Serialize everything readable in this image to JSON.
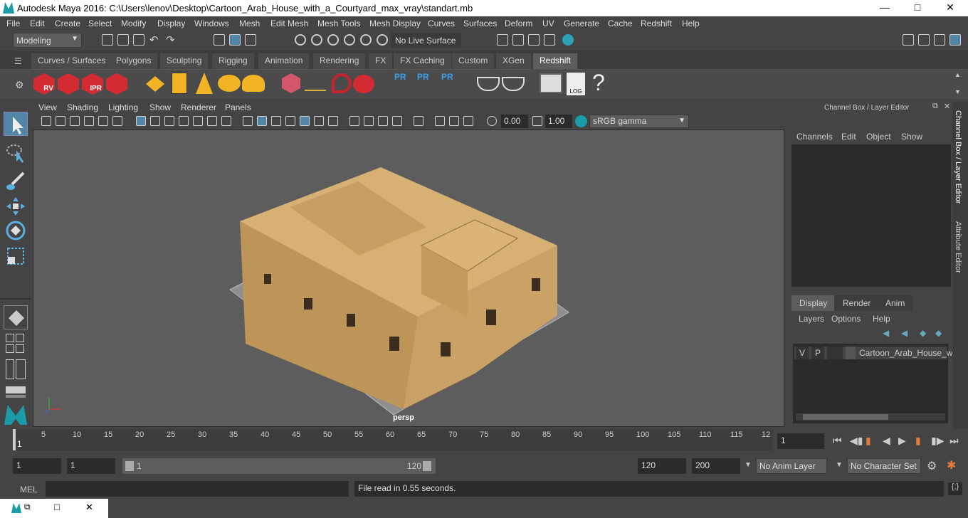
{
  "window": {
    "title": "Autodesk Maya 2016: C:\\Users\\lenov\\Desktop\\Cartoon_Arab_House_with_a_Courtyard_max_vray\\standart.mb"
  },
  "menu": [
    "File",
    "Edit",
    "Create",
    "Select",
    "Modify",
    "Display",
    "Windows",
    "Mesh",
    "Edit Mesh",
    "Mesh Tools",
    "Mesh Display",
    "Curves",
    "Surfaces",
    "Deform",
    "UV",
    "Generate",
    "Cache",
    "Redshift",
    "Help"
  ],
  "status": {
    "mode": "Modeling",
    "live_surface": "No Live Surface"
  },
  "shelf_tabs": [
    "Curves / Surfaces",
    "Polygons",
    "Sculpting",
    "Rigging",
    "Animation",
    "Rendering",
    "FX",
    "FX Caching",
    "Custom",
    "XGen",
    "Redshift"
  ],
  "shelf": {
    "rv": "RV",
    "ipr": "IPR",
    "pr": "PR",
    "log": "LOG",
    "help": "?"
  },
  "viewport_menu": [
    "View",
    "Shading",
    "Lighting",
    "Show",
    "Renderer",
    "Panels"
  ],
  "viewport_toolbar": {
    "exposure": "0.00",
    "gamma": "1.00",
    "colorspace": "sRGB gamma"
  },
  "viewport": {
    "camera_label": "persp"
  },
  "channel_box": {
    "title": "Channel Box / Layer Editor",
    "menu": [
      "Channels",
      "Edit",
      "Object",
      "Show"
    ]
  },
  "layer_editor": {
    "tabs": [
      "Display",
      "Render",
      "Anim"
    ],
    "menu": [
      "Layers",
      "Options",
      "Help"
    ],
    "layer": {
      "v": "V",
      "p": "P",
      "name": "Cartoon_Arab_House_wi"
    }
  },
  "side_tabs": [
    "Channel Box / Layer Editor",
    "Attribute Editor"
  ],
  "timeline": {
    "ticks": [
      "5",
      "10",
      "15",
      "20",
      "25",
      "30",
      "35",
      "40",
      "45",
      "50",
      "55",
      "60",
      "65",
      "70",
      "75",
      "80",
      "85",
      "90",
      "95",
      "100",
      "105",
      "110",
      "115",
      "12"
    ],
    "start_label": "1",
    "current_frame": "1"
  },
  "range": {
    "start": "1",
    "playback_start": "1",
    "slider_start": "1",
    "slider_end": "120",
    "playback_end": "120",
    "end": "200",
    "anim_layer": "No Anim Layer",
    "character_set": "No Character Set"
  },
  "command": {
    "lang": "MEL",
    "result": "File read in  0.55 seconds."
  },
  "colors": {
    "accent": "#1a9ca8",
    "redshift": "#d42b33",
    "bg": "#444444",
    "viewport": "#5d5d5d"
  }
}
